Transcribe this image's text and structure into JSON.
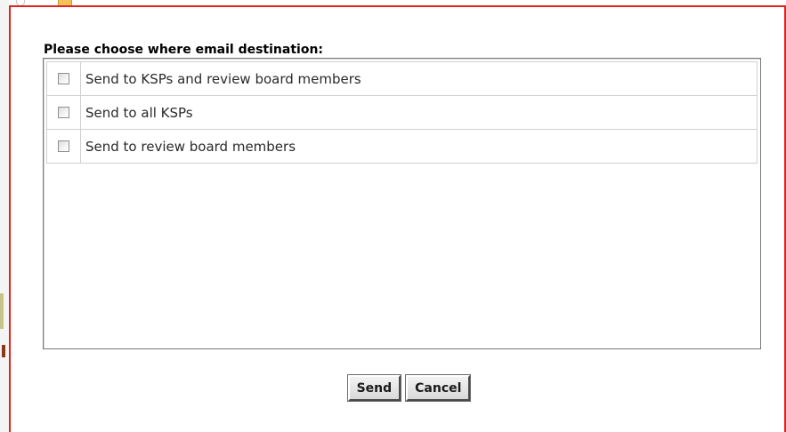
{
  "dialog": {
    "prompt": "Please choose where email destination:",
    "options": [
      {
        "label": "Send to KSPs and review board members",
        "checked": false
      },
      {
        "label": "Send to all KSPs",
        "checked": false
      },
      {
        "label": "Send to review board members",
        "checked": false
      }
    ],
    "buttons": {
      "send": "Send",
      "cancel": "Cancel"
    }
  },
  "colors": {
    "frame": "#e0231e"
  }
}
